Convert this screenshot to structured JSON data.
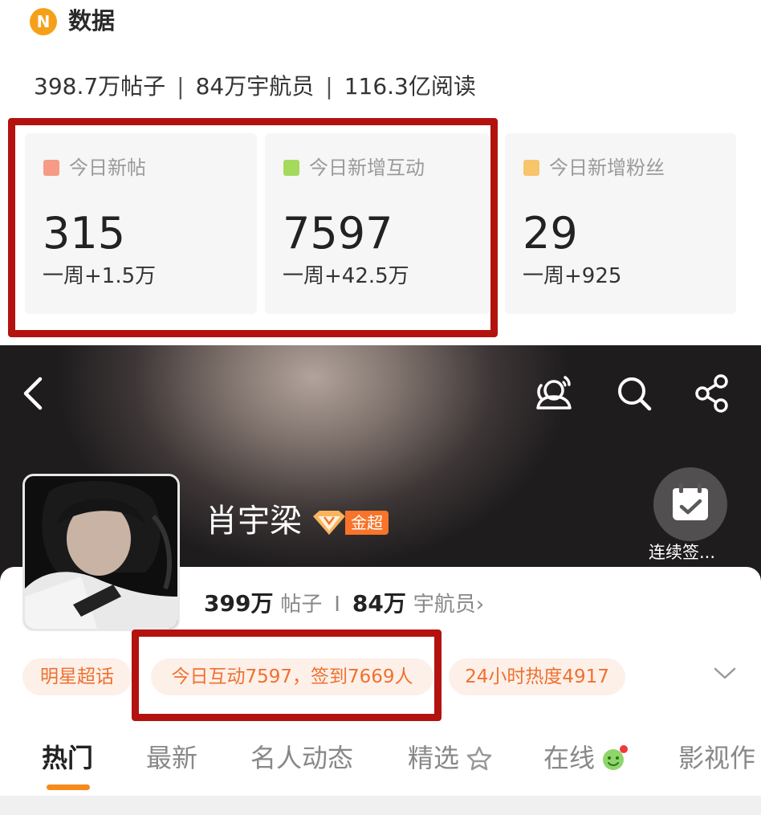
{
  "section": {
    "logo_letter": "N",
    "title": "数据"
  },
  "summary": {
    "posts": "398.7万帖子",
    "members": "84万宇航员",
    "reads": "116.3亿阅读",
    "separator": "|"
  },
  "cards": [
    {
      "label": "今日新帖",
      "value": "315",
      "weekly": "一周+1.5万",
      "color": "#f79a86"
    },
    {
      "label": "今日新增互动",
      "value": "7597",
      "weekly": "一周+42.5万",
      "color": "#a5da5c"
    },
    {
      "label": "今日新增粉丝",
      "value": "29",
      "weekly": "一周+925",
      "color": "#f8c56c"
    }
  ],
  "topbar": {
    "icons": [
      "back-icon",
      "chat-icon",
      "search-icon",
      "share-icon"
    ]
  },
  "profile": {
    "name": "肖宇梁",
    "badge": "金超",
    "checkin_label": "连续签...",
    "posts_num": "399万",
    "posts_unit": "帖子",
    "divider": "I",
    "members_num": "84万",
    "members_unit": "宇航员",
    "chevron": "›"
  },
  "pills": [
    "明星超话",
    "今日互动7597，签到7669人",
    "24小时热度4917"
  ],
  "tabs": [
    "热门",
    "最新",
    "名人动态",
    "精选",
    "在线",
    "影视作"
  ],
  "colors": {
    "accent": "#f68a1c",
    "highlight": "#b3120f",
    "pill_text": "#f07030",
    "pill_bg": "#fdf0e8"
  }
}
